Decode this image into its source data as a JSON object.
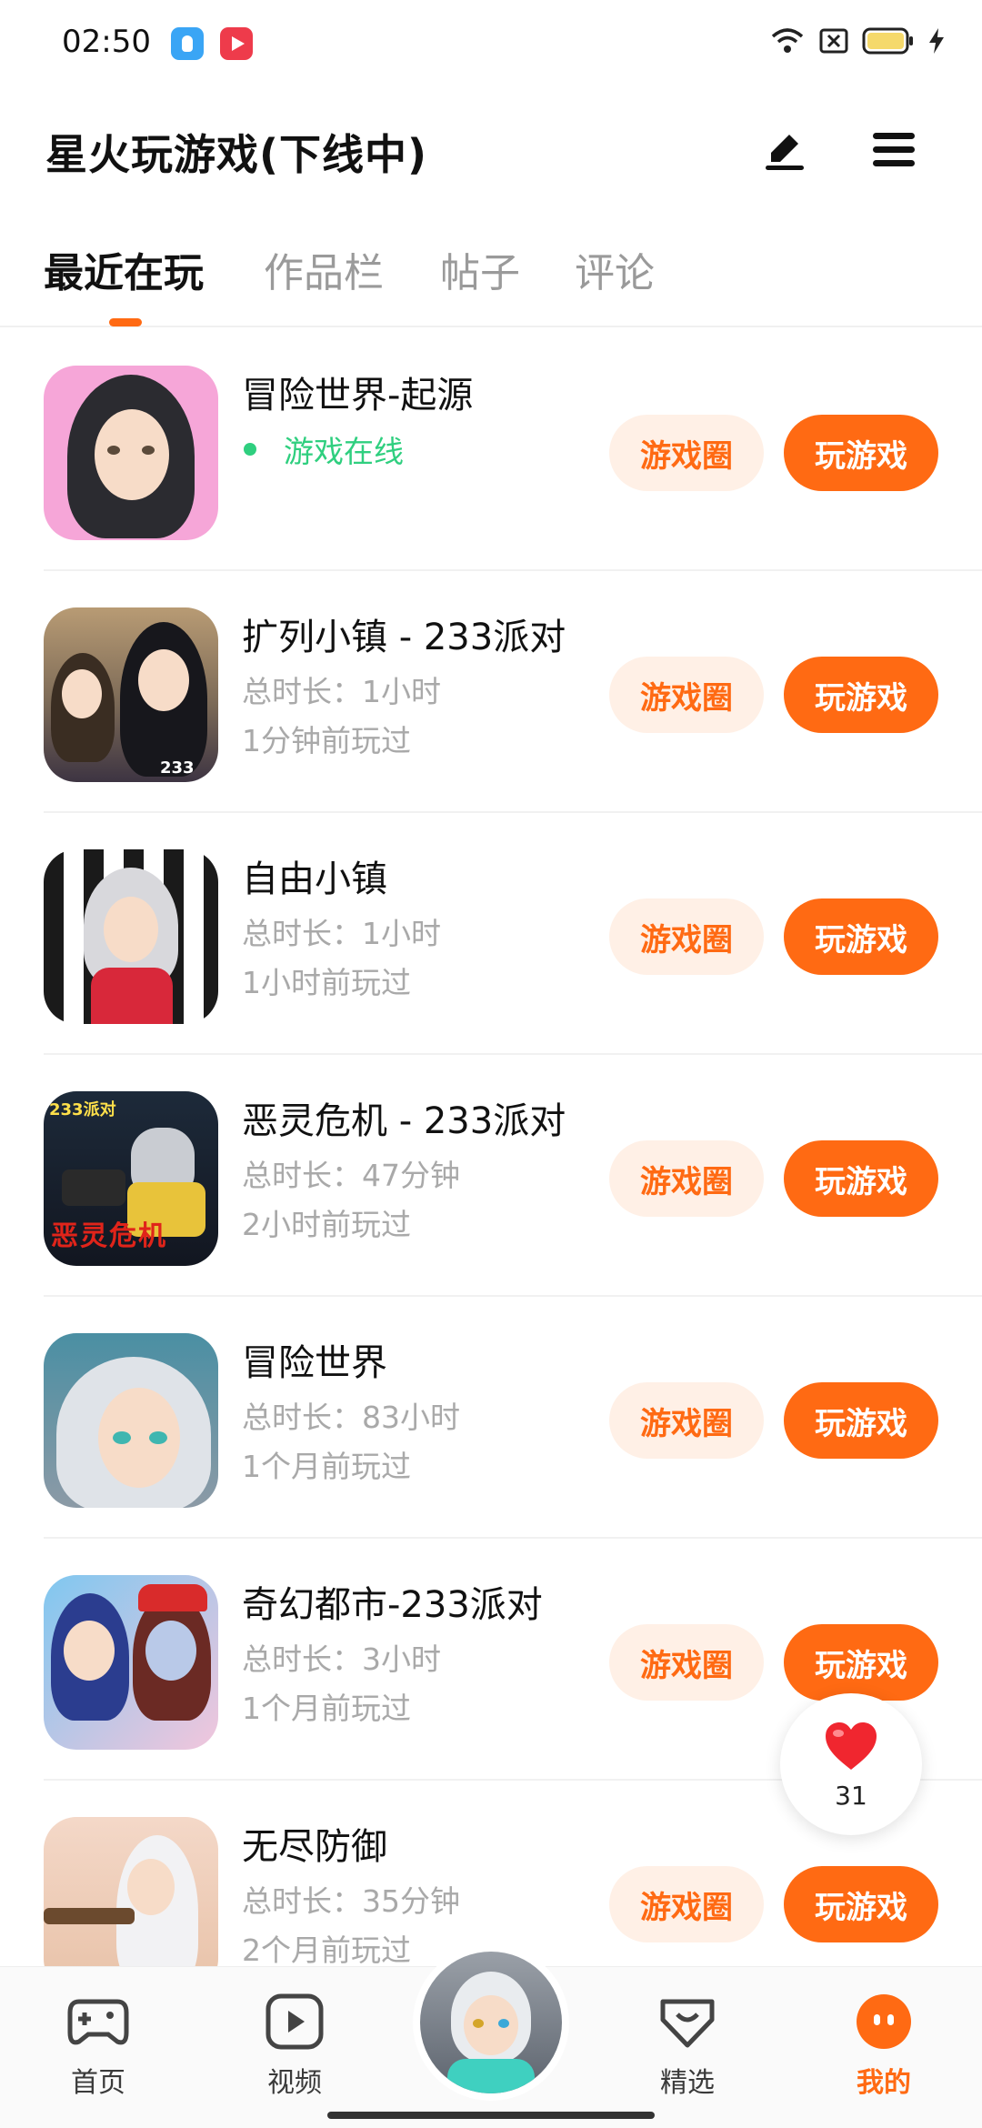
{
  "status_bar": {
    "time": "02:50",
    "icons": [
      "wifi-icon",
      "close-box-icon",
      "battery-icon",
      "charging-icon"
    ]
  },
  "header": {
    "title": "星火玩游戏(下线中)",
    "edit_icon": "edit-icon",
    "menu_icon": "menu-icon"
  },
  "tabs": [
    {
      "label": "最近在玩",
      "active": true
    },
    {
      "label": "作品栏",
      "active": false
    },
    {
      "label": "帖子",
      "active": false
    },
    {
      "label": "评论",
      "active": false
    }
  ],
  "games": [
    {
      "name": "冒险世界-起源",
      "online": "游戏在线",
      "circle_label": "游戏圈",
      "play_label": "玩游戏"
    },
    {
      "name": "扩列小镇 - 233派对",
      "duration": "总时长：1小时",
      "last_played": "1分钟前玩过",
      "circle_label": "游戏圈",
      "play_label": "玩游戏"
    },
    {
      "name": "自由小镇",
      "duration": "总时长：1小时",
      "last_played": "1小时前玩过",
      "circle_label": "游戏圈",
      "play_label": "玩游戏"
    },
    {
      "name": "恶灵危机 - 233派对",
      "duration": "总时长：47分钟",
      "last_played": "2小时前玩过",
      "circle_label": "游戏圈",
      "play_label": "玩游戏"
    },
    {
      "name": "冒险世界",
      "duration": "总时长：83小时",
      "last_played": "1个月前玩过",
      "circle_label": "游戏圈",
      "play_label": "玩游戏"
    },
    {
      "name": "奇幻都市-233派对",
      "duration": "总时长：3小时",
      "last_played": "1个月前玩过",
      "circle_label": "游戏圈",
      "play_label": "玩游戏"
    },
    {
      "name": "无尽防御",
      "duration": "总时长：35分钟",
      "last_played": "2个月前玩过",
      "circle_label": "游戏圈",
      "play_label": "玩游戏"
    }
  ],
  "icon_art": {
    "art2_tag": "233",
    "art4_tag": "233派对",
    "art4_title": "恶灵危机"
  },
  "like": {
    "count": "31"
  },
  "bottom_nav": [
    {
      "label": "首页",
      "icon": "gamepad-icon"
    },
    {
      "label": "视频",
      "icon": "video-icon"
    },
    {
      "label": "",
      "icon": "avatar"
    },
    {
      "label": "精选",
      "icon": "heart-box-icon"
    },
    {
      "label": "我的",
      "icon": "profile-icon"
    }
  ],
  "colors": {
    "accent": "#ff6a13",
    "online": "#2fcf7f",
    "muted": "#a9a9a9"
  }
}
